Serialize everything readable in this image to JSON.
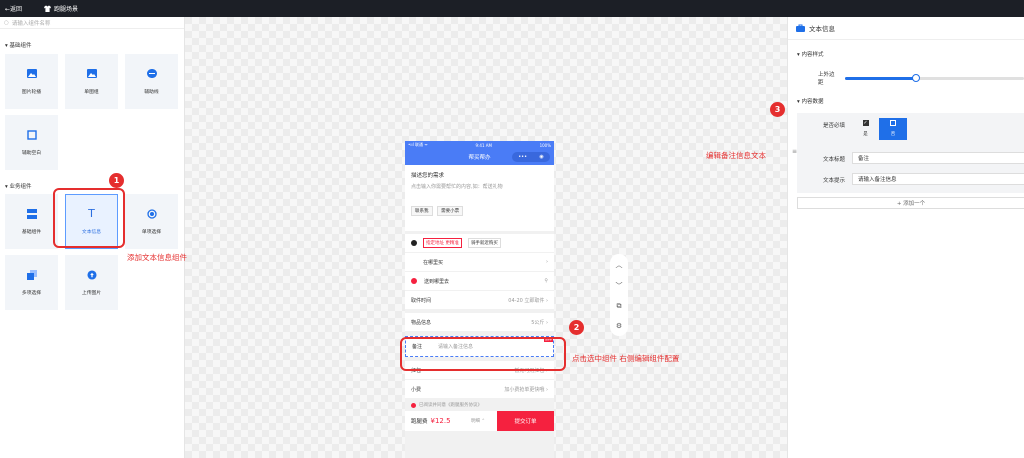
{
  "topbar": {
    "back": "←返回",
    "scene": "跑腿场景"
  },
  "left": {
    "search_placeholder": "请输入组件名称",
    "basic_title": "▾ 基础组件",
    "basic": [
      "图片轮播",
      "单图组",
      "辅助线",
      "辅助空白"
    ],
    "business_title": "▾ 业务组件",
    "business": [
      "基础组件",
      "文本信息",
      "单项选择",
      "多项选择",
      "上传图片"
    ]
  },
  "phone": {
    "status_left": "•ııl 联通 ᯤ",
    "status_time": "9:41 AM",
    "status_right": "100%",
    "nav_title": "帮买帮办",
    "nav_dots": "•••",
    "nav_circle": "◉",
    "desc_title": "描述您的需求",
    "desc_placeholder": "点击输入你需要帮忙的内容,如：帮送礼物",
    "tags": [
      "联系我",
      "需要小票"
    ],
    "buy_mode_selected": "指定地址 更精准",
    "buy_mode_other": "骑手就近购买",
    "buy_place": "在哪里买",
    "deliver": "送到哪里去",
    "pickup_label": "取件时间",
    "pickup_value": "04-20 立即取件",
    "goods_label": "物品信息",
    "goods_value": "5公斤",
    "note_label": "备注",
    "note_placeholder": "请输入备注信息",
    "delete_tag": "删除",
    "redpack_label": "红包",
    "redpack_value": "暂无可用红包",
    "tip_label": "小费",
    "tip_value": "加小费抢单更快哦",
    "agree_text": "已阅读并同意《跑腿服务协议》",
    "fee_label": "跑腿费",
    "fee_value": "¥12.5",
    "detail": "明细",
    "submit": "提交订单"
  },
  "annotations": {
    "a1": "1",
    "a1_text": "添加文本信息组件",
    "a2": "2",
    "a2_text": "点击选中组件 右侧编辑组件配置",
    "a3": "3",
    "a3_text": "编辑备注信息文本"
  },
  "right": {
    "title": "文本信息",
    "style_section": "▾ 内容样式",
    "padding_label": "上外边距",
    "padding_level": 0.4,
    "data_section": "▾ 内容数据",
    "required_label": "是否必填",
    "yes": "是",
    "no": "否",
    "title_label": "文本标题",
    "title_value": "备注",
    "hint_label": "文本提示",
    "hint_value": "请输入备注信息",
    "add_button": "+ 添加一个"
  },
  "colors": {
    "accent": "#4a7cf6",
    "annotation": "#e52e2e",
    "submit": "#f5213f"
  }
}
